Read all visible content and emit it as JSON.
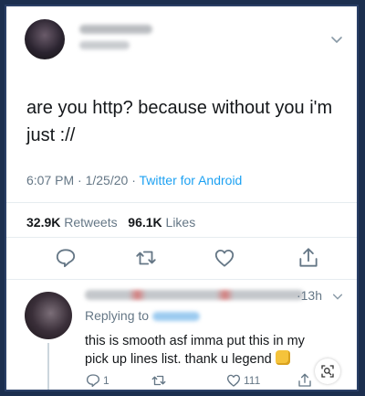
{
  "tweet": {
    "text": "are you http? because without you i'm just ://",
    "time": "6:07 PM",
    "date": "1/25/20",
    "sep": "·",
    "app": "Twitter for Android",
    "retweets_count": "32.9K",
    "retweets_label": "Retweets",
    "likes_count": "96.1K",
    "likes_label": "Likes"
  },
  "reply": {
    "time": "13h",
    "time_sep": "·",
    "replying_prefix": "Replying to",
    "text": "this is smooth asf imma put this in my pick up lines list. thank u legend",
    "reply_count": "1",
    "like_count": "111"
  },
  "colors": {
    "accent": "#1da1f2",
    "muted": "#657786",
    "frame": "#1c2f4f"
  },
  "icons": {
    "tweet_actions": [
      "reply-icon",
      "retweet-icon",
      "like-icon",
      "share-icon"
    ],
    "reply_actions": [
      "reply-icon",
      "retweet-icon",
      "like-icon",
      "share-icon"
    ],
    "overlay": "lens-search-icon",
    "emoji": "raised-fist-emoji"
  }
}
